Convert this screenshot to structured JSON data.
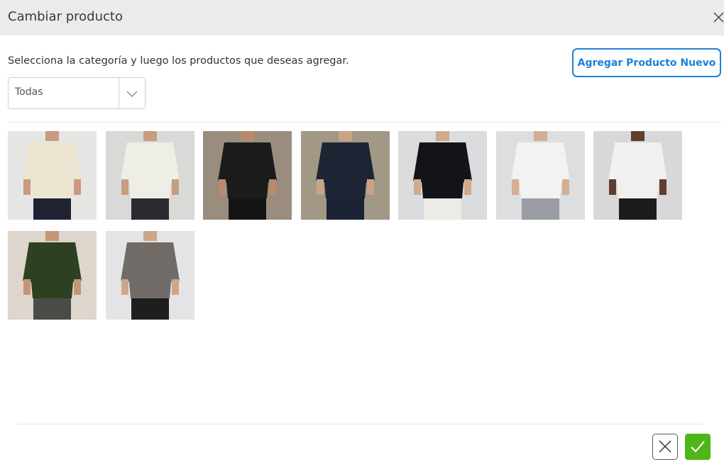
{
  "dialog": {
    "title": "Cambiar producto",
    "close_icon": "close-icon"
  },
  "instructions": "Selecciona la categoría y luego los productos que deseas agregar.",
  "add_new_button": "Agregar Producto Nuevo",
  "category_select": {
    "selected": "Todas",
    "icon": "chevron-down-icon"
  },
  "products": [
    {
      "name": "product-cream-shirt",
      "background": "#e6e6e4",
      "garment": "#ece5d2",
      "pants": "#1e2233",
      "skin": "#c99a7e"
    },
    {
      "name": "product-striped-shirt",
      "background": "#d9d9d7",
      "garment": "#efeee6",
      "pants": "#2a2a30",
      "skin": "#c89c7f"
    },
    {
      "name": "product-black-shirt",
      "background": "#9b8d7e",
      "garment": "#1a1c1c",
      "pants": "#151515",
      "skin": "#b98a6d"
    },
    {
      "name": "product-navy-jacket",
      "background": "#a19886",
      "garment": "#1d2535",
      "pants": "#1a2233",
      "skin": "#caa284"
    },
    {
      "name": "product-black-short-sleeve",
      "background": "#dadcdd",
      "garment": "#121417",
      "pants": "#ecebe6",
      "skin": "#d1aa8e"
    },
    {
      "name": "product-white-tee-grey-pants",
      "background": "#dcdee0",
      "garment": "#f2f2f0",
      "pants": "#9a9da3",
      "skin": "#d4ae92"
    },
    {
      "name": "product-white-polo",
      "background": "#d8d8d8",
      "garment": "#f1f0ee",
      "pants": "#1c1c1c",
      "skin": "#5e3f2e"
    },
    {
      "name": "product-green-tee",
      "background": "#ded6cc",
      "garment": "#2d4021",
      "pants": "#494c47",
      "skin": "#c49676"
    },
    {
      "name": "product-grey-tee",
      "background": "#e4e4e6",
      "garment": "#716b67",
      "pants": "#1e1e1e",
      "skin": "#cfa588"
    }
  ],
  "footer": {
    "cancel_icon": "close-icon",
    "confirm_icon": "check-icon",
    "confirm_color": "#4fb61a"
  },
  "colors": {
    "accent": "#1e7fd8",
    "header_bg": "#ebebeb"
  }
}
